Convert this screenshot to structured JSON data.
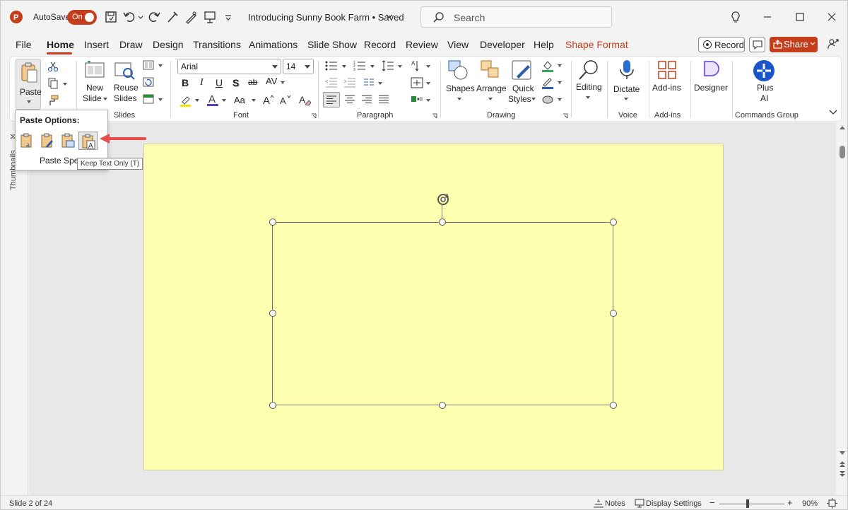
{
  "app": {
    "autosave_label": "AutoSave",
    "autosave_state": "On",
    "doc_title": "Introducing Sunny Book Farm • Saved"
  },
  "search": {
    "placeholder": "Search"
  },
  "tabs": [
    "File",
    "Home",
    "Insert",
    "Draw",
    "Design",
    "Transitions",
    "Animations",
    "Slide Show",
    "Record",
    "Review",
    "View",
    "Developer",
    "Help",
    "Shape Format"
  ],
  "actions": {
    "record": "Record",
    "share": "Share"
  },
  "ribbon": {
    "paste": "Paste",
    "new_slide_1": "New",
    "new_slide_2": "Slide",
    "reuse_1": "Reuse",
    "reuse_2": "Slides",
    "font_name": "Arial",
    "font_size": "14",
    "bold": "B",
    "italic": "I",
    "underline": "U",
    "shadow": "S",
    "strike": "ab",
    "spacing": "AV",
    "case": "Aa",
    "shapes": "Shapes",
    "arrange": "Arrange",
    "quick_styles_1": "Quick",
    "quick_styles_2": "Styles",
    "editing": "Editing",
    "dictate": "Dictate",
    "addins": "Add-ins",
    "designer": "Designer",
    "plus_ai_1": "Plus",
    "plus_ai_2": "AI",
    "groups": {
      "slides": "Slides",
      "font": "Font",
      "paragraph": "Paragraph",
      "drawing": "Drawing",
      "voice": "Voice",
      "addins": "Add-ins",
      "commands": "Commands Group"
    }
  },
  "paste_popup": {
    "title": "Paste Options:",
    "special": "Paste Spec",
    "tooltip": "Keep Text Only (T)"
  },
  "thumbnails_label": "Thumbnails",
  "status": {
    "slide": "Slide 2 of 24",
    "notes": "Notes",
    "display": "Display Settings",
    "zoom": "90%"
  },
  "colors": {
    "accent": "#c43e1c",
    "slide_bg": "#ffffb0"
  }
}
